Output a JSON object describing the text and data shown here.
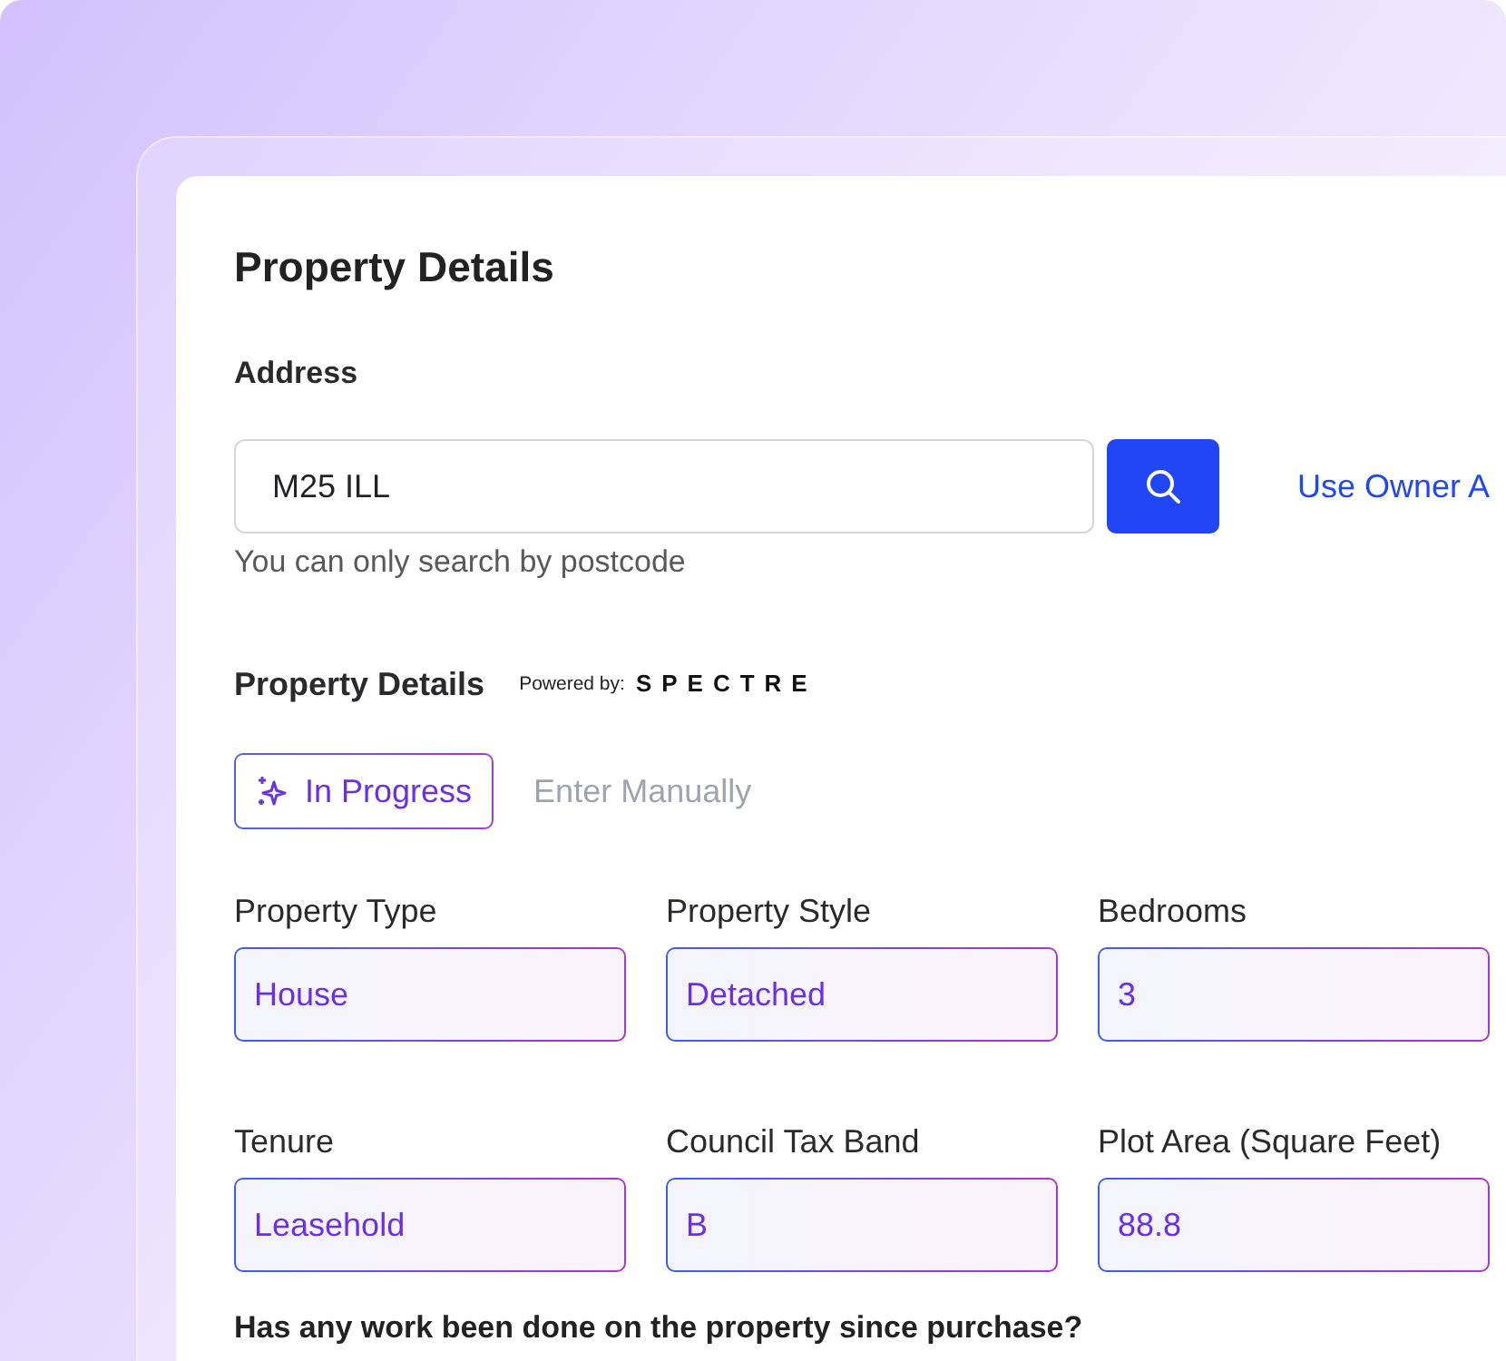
{
  "title": "Property Details",
  "address": {
    "label": "Address",
    "value": "M25 ILL",
    "helper_text": "You can only search by postcode",
    "link": "Use Owner A"
  },
  "details": {
    "heading": "Property Details",
    "powered_by": "Powered by:",
    "logo": "SPECTRE"
  },
  "tabs": [
    {
      "label": "In Progress",
      "selected": true
    },
    {
      "label": "Enter Manually",
      "selected": false
    }
  ],
  "fields": [
    {
      "label": "Property Type",
      "value": "House"
    },
    {
      "label": "Property Style",
      "value": "Detached"
    },
    {
      "label": "Bedrooms",
      "value": "3"
    },
    {
      "label": "Tenure",
      "value": "Leasehold"
    },
    {
      "label": "Council Tax Band",
      "value": "B"
    },
    {
      "label": "Plot Area (Square Feet)",
      "value": "88.8"
    }
  ],
  "question": "Has any work been done on the property since purchase?"
}
